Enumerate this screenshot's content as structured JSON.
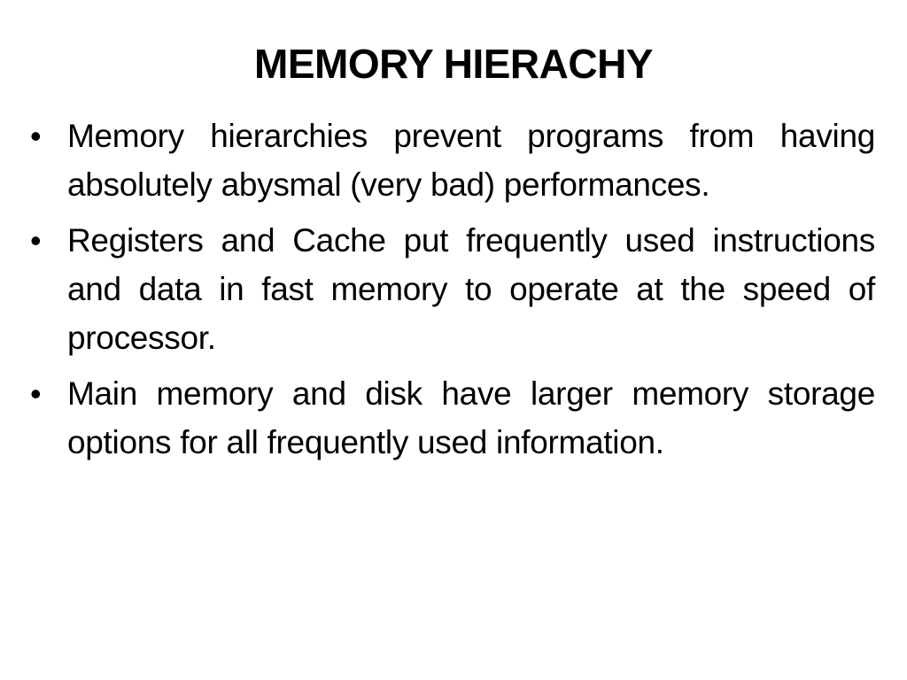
{
  "slide": {
    "title": "MEMORY HIERACHY",
    "bullets": [
      {
        "marker": "•",
        "text": "Memory hierarchies prevent programs from having absolutely abysmal (very bad) performances."
      },
      {
        "marker": "•",
        "text": "Registers and Cache put frequently used instructions and data in fast memory to operate at the speed of processor."
      },
      {
        "marker": "•",
        "text": "Main memory and disk have larger memory storage options for all frequently used information."
      }
    ]
  },
  "colors": {
    "background": "#ffffff",
    "text": "#000000"
  }
}
